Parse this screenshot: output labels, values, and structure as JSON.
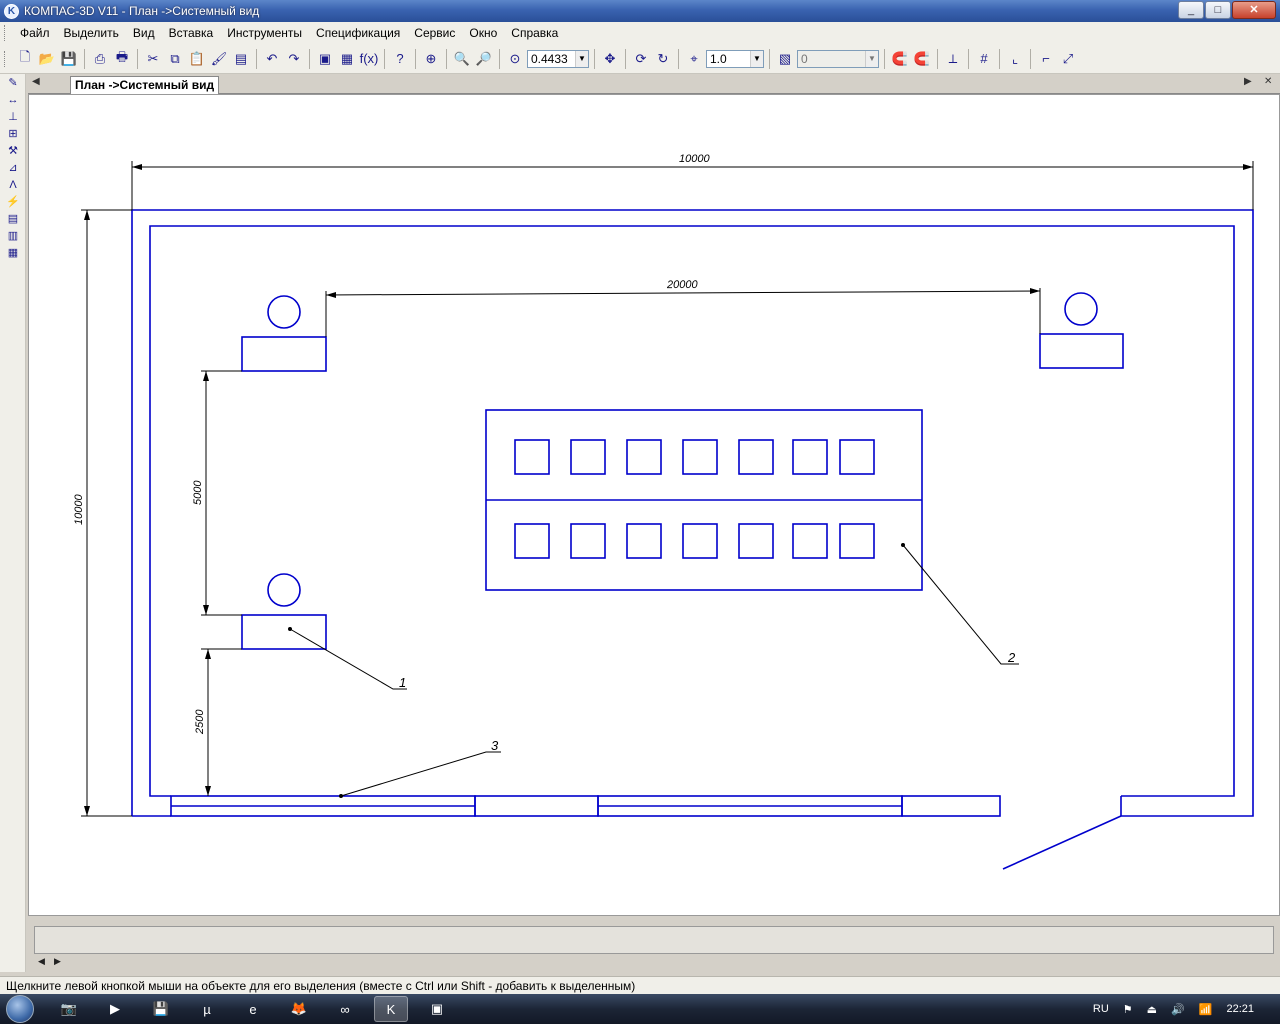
{
  "window": {
    "title": "КОМПАС-3D V11 - План ->Системный вид",
    "minimize": "_",
    "maximize": "□",
    "close": "✕"
  },
  "menu": [
    "Файл",
    "Выделить",
    "Вид",
    "Вставка",
    "Инструменты",
    "Спецификация",
    "Сервис",
    "Окно",
    "Справка"
  ],
  "toolbar": {
    "zoom_value": "0.4433",
    "step_value": "1.0",
    "layer_value": "0"
  },
  "doc_tab": {
    "label": "План ->Системный вид"
  },
  "drawing": {
    "dim_overall_width": "10000",
    "dim_overall_height": "10000",
    "dim_between_tables": "20000",
    "dim_vertical_gap": "5000",
    "dim_to_wall": "2500",
    "leader_1": "1",
    "leader_2": "2",
    "leader_3": "3",
    "line_color": "#0000cc"
  },
  "status": {
    "hint": "Щелкните левой кнопкой мыши на объекте для его выделения (вместе с Ctrl или Shift - добавить к выделенным)"
  },
  "tray": {
    "lang": "RU",
    "time": "22:21"
  }
}
